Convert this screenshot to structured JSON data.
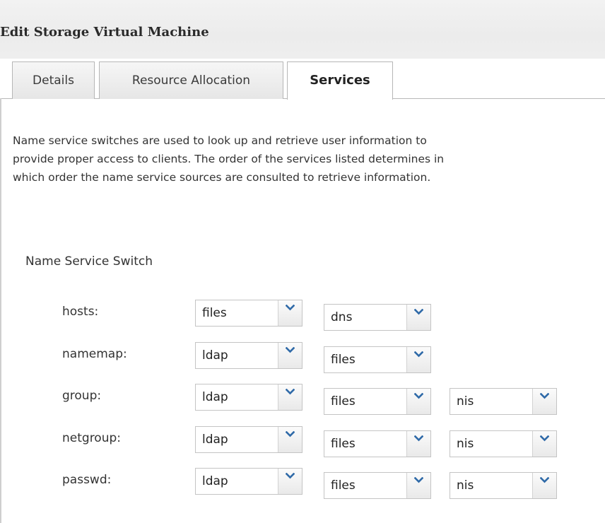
{
  "dialog": {
    "title": "Edit Storage Virtual Machine"
  },
  "tabs": [
    {
      "label": "Details",
      "active": false
    },
    {
      "label": "Resource Allocation",
      "active": false
    },
    {
      "label": "Services",
      "active": true
    }
  ],
  "services": {
    "description_lines": [
      "Name service switches are used to look up and retrieve user information to",
      "provide proper access to clients. The order of the services listed determines in",
      "which order the name service sources are consulted to retrieve information."
    ],
    "section_title": "Name Service Switch",
    "rows": [
      {
        "label": "hosts:",
        "sources": [
          "files",
          "dns"
        ]
      },
      {
        "label": "namemap:",
        "sources": [
          "ldap",
          "files"
        ]
      },
      {
        "label": "group:",
        "sources": [
          "ldap",
          "files",
          "nis"
        ]
      },
      {
        "label": "netgroup:",
        "sources": [
          "ldap",
          "files",
          "nis"
        ]
      },
      {
        "label": "passwd:",
        "sources": [
          "ldap",
          "files",
          "nis"
        ]
      }
    ]
  },
  "icons": {
    "dropdown": "chevron-down-icon"
  },
  "colors": {
    "chevron": "#2f6aa8"
  }
}
